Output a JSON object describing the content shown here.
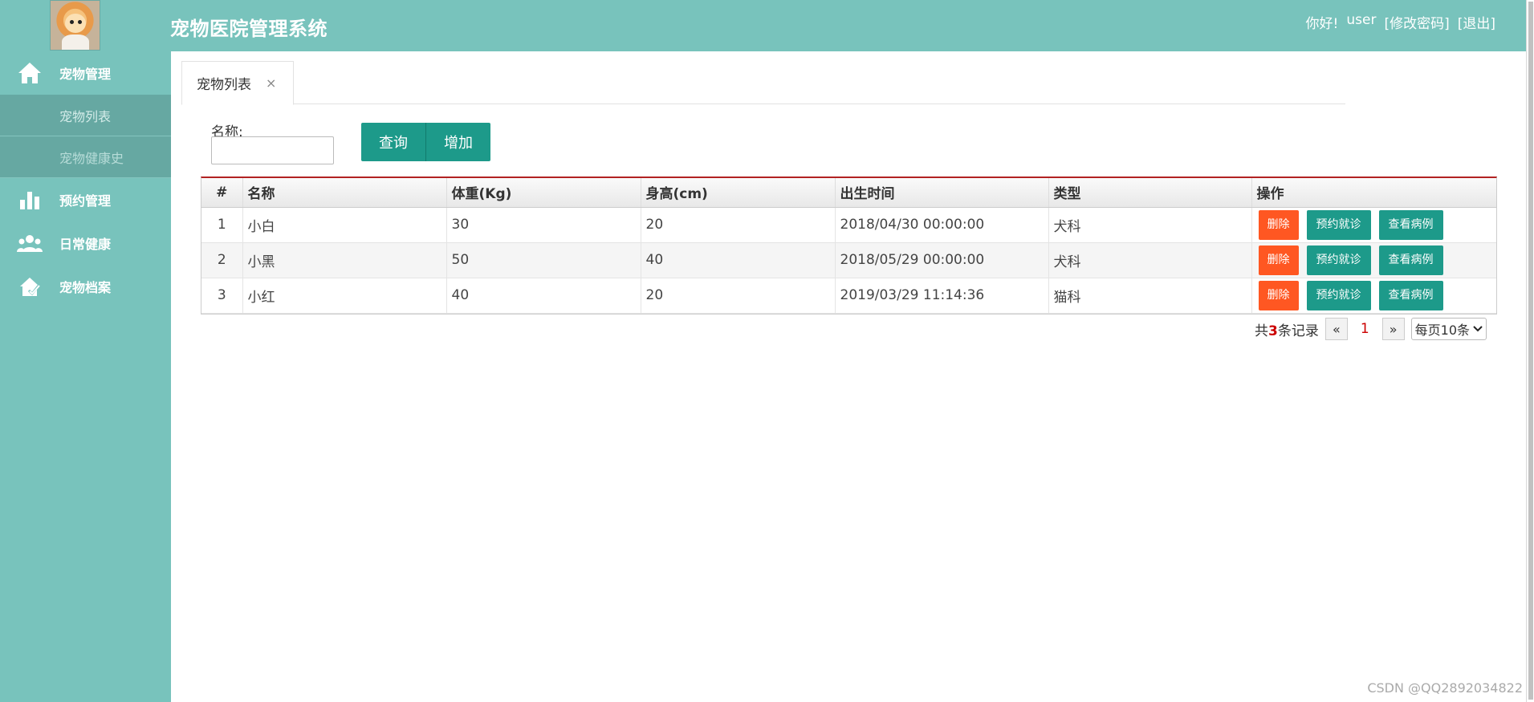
{
  "header": {
    "title": "宠物医院管理系统",
    "greeting": "你好!",
    "username": "user",
    "change_password": "[修改密码]",
    "logout": "[退出]"
  },
  "sidebar": {
    "items": [
      {
        "label": "宠物管理",
        "icon": "home-icon"
      },
      {
        "label": "宠物列表",
        "sub": true,
        "active": true
      },
      {
        "label": "宠物健康史",
        "sub": true
      },
      {
        "label": "预约管理",
        "icon": "bar-chart-icon"
      },
      {
        "label": "日常健康",
        "icon": "users-icon"
      },
      {
        "label": "宠物档案",
        "icon": "pet-file-icon"
      }
    ]
  },
  "tabs": [
    {
      "label": "宠物列表",
      "close": "×"
    }
  ],
  "search": {
    "label": "名称:",
    "value": "",
    "placeholder": "",
    "query_button": "查询",
    "add_button": "增加"
  },
  "table": {
    "columns": [
      "#",
      "名称",
      "体重(Kg)",
      "身高(cm)",
      "出生时间",
      "类型",
      "操作"
    ],
    "rows": [
      {
        "num": "1",
        "name": "小白",
        "weight": "30",
        "height": "20",
        "birth": "2018/04/30 00:00:00",
        "type": "犬科"
      },
      {
        "num": "2",
        "name": "小黑",
        "weight": "50",
        "height": "40",
        "birth": "2018/05/29 00:00:00",
        "type": "犬科"
      },
      {
        "num": "3",
        "name": "小红",
        "weight": "40",
        "height": "20",
        "birth": "2019/03/29 11:14:36",
        "type": "猫科"
      }
    ],
    "actions": {
      "delete": "删除",
      "appointment": "预约就诊",
      "cases": "查看病例"
    }
  },
  "pager": {
    "prefix": "共",
    "total": "3",
    "suffix": "条记录",
    "prev": "«",
    "current": "1",
    "next": "»",
    "page_size": "每页10条"
  },
  "watermark": "CSDN @QQ2892034822",
  "colors": {
    "primary": "#78c3bc",
    "teal_button": "#1d9a8a",
    "danger": "#ff5722"
  }
}
